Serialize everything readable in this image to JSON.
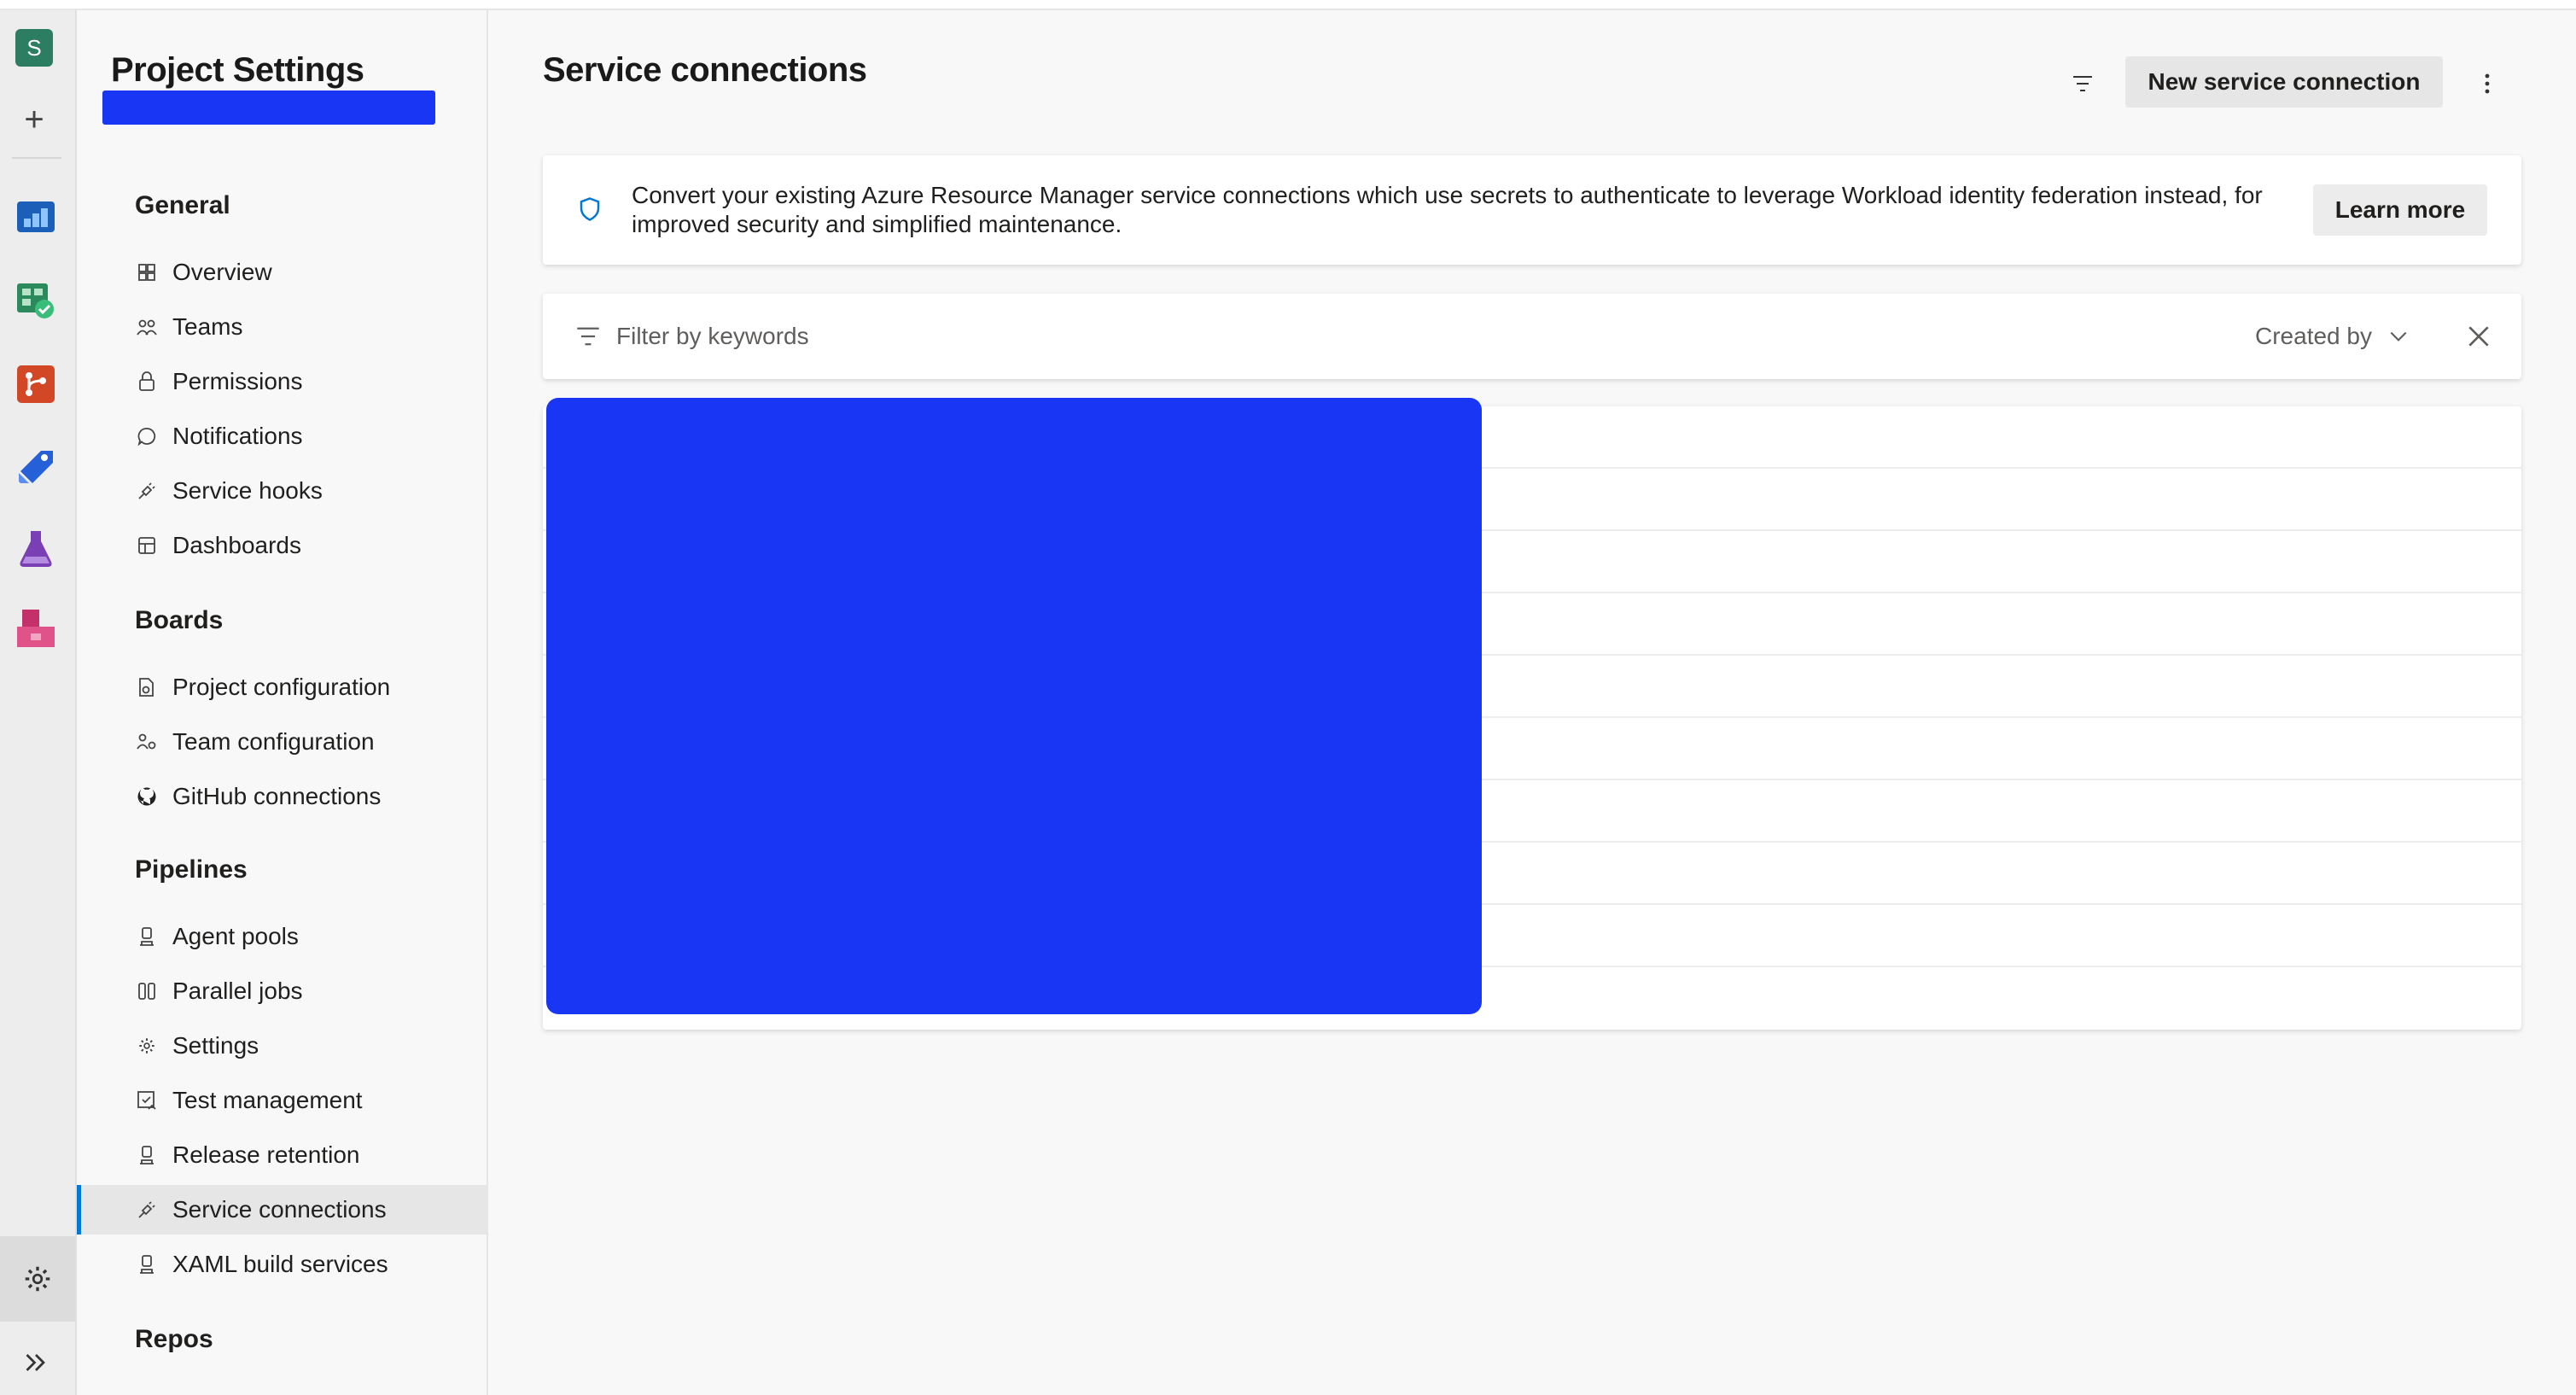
{
  "rail": {
    "org_initial": "S",
    "services": [
      {
        "name": "overview",
        "color": "#1c5fb8"
      },
      {
        "name": "boards",
        "color": "#2b8a5b"
      },
      {
        "name": "repos",
        "color": "#d24726"
      },
      {
        "name": "pipelines",
        "color": "#2560d8"
      },
      {
        "name": "test-plans",
        "color": "#7a3fb5"
      },
      {
        "name": "artifacts",
        "color": "#c3306a"
      }
    ]
  },
  "nav": {
    "title": "Project Settings",
    "sections": [
      {
        "label": "General",
        "items": [
          "Overview",
          "Teams",
          "Permissions",
          "Notifications",
          "Service hooks",
          "Dashboards"
        ]
      },
      {
        "label": "Boards",
        "items": [
          "Project configuration",
          "Team configuration",
          "GitHub connections"
        ]
      },
      {
        "label": "Pipelines",
        "items": [
          "Agent pools",
          "Parallel jobs",
          "Settings",
          "Test management",
          "Release retention",
          "Service connections",
          "XAML build services"
        ]
      },
      {
        "label": "Repos",
        "items": []
      }
    ],
    "active_item": "Service connections"
  },
  "main": {
    "title": "Service connections",
    "new_button": "New service connection",
    "banner": {
      "message": "Convert your existing Azure Resource Manager service connections which use secrets to authenticate to leverage Workload identity federation instead, for improved security and simplified maintenance.",
      "learn_more": "Learn more"
    },
    "filter": {
      "placeholder": "Filter by keywords",
      "created_by": "Created by"
    },
    "row_count": 10
  },
  "colors": {
    "accent": "#0078d4",
    "redaction": "#1a36f5"
  }
}
